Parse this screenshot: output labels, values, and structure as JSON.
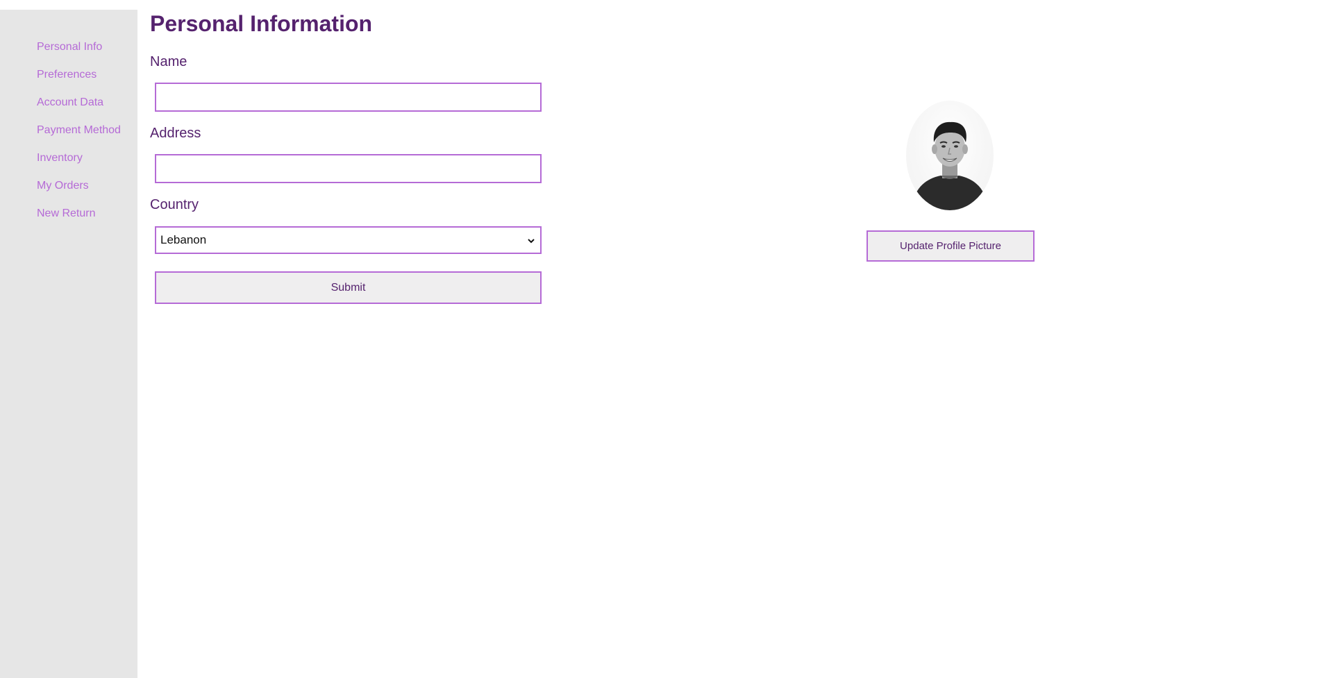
{
  "sidebar": {
    "items": [
      {
        "label": "Personal Info"
      },
      {
        "label": "Preferences"
      },
      {
        "label": "Account Data"
      },
      {
        "label": "Payment Method"
      },
      {
        "label": "Inventory"
      },
      {
        "label": "My Orders"
      },
      {
        "label": "New Return"
      }
    ]
  },
  "form": {
    "title": "Personal Information",
    "name_label": "Name",
    "name_value": "",
    "address_label": "Address",
    "address_value": "",
    "country_label": "Country",
    "country_selected": "Lebanon",
    "submit_label": "Submit"
  },
  "profile": {
    "avatar_icon": "user-photo",
    "update_label": "Update Profile Picture"
  },
  "colors": {
    "accent": "#b56ad6",
    "heading": "#55226e",
    "sidebar_bg": "#e6e6e6",
    "button_bg": "#efeeef"
  },
  "icons": {
    "select_arrow": "chevron-down-icon"
  }
}
